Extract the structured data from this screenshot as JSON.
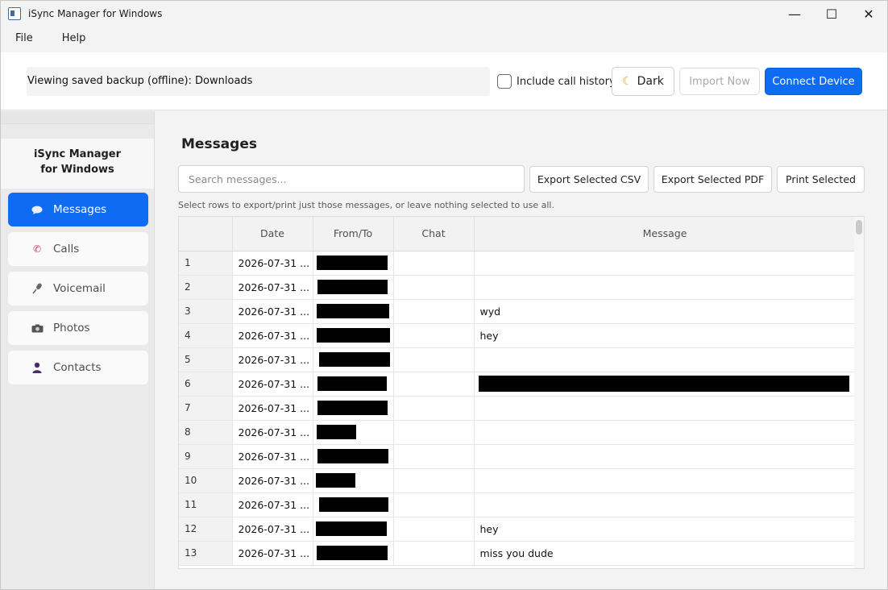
{
  "window": {
    "title": "iSync Manager for Windows",
    "controls": {
      "minimize": "—",
      "maximize": "☐",
      "close": "✕"
    }
  },
  "menu": {
    "items": [
      "File",
      "Help"
    ]
  },
  "toolbar": {
    "status": "Viewing saved backup (offline): Downloads",
    "include_call_history_label": "Include call history",
    "include_call_history_checked": false,
    "dark_label": "Dark",
    "import_label": "Import Now",
    "connect_label": "Connect Device"
  },
  "sidebar": {
    "header_line1": "iSync Manager",
    "header_line2": "for Windows",
    "items": [
      {
        "label": "Messages",
        "icon": "speech-bubble-icon",
        "glyph": "💬",
        "active": true
      },
      {
        "label": "Calls",
        "icon": "phone-icon",
        "glyph": "📞",
        "active": false
      },
      {
        "label": "Voicemail",
        "icon": "microphone-icon",
        "glyph": "🎤",
        "active": false
      },
      {
        "label": "Photos",
        "icon": "camera-icon",
        "glyph": "📷",
        "active": false
      },
      {
        "label": "Contacts",
        "icon": "person-icon",
        "glyph": "👤",
        "active": false
      }
    ]
  },
  "main": {
    "title": "Messages",
    "search_placeholder": "Search messages...",
    "export_csv_label": "Export Selected CSV",
    "export_pdf_label": "Export Selected PDF",
    "print_label": "Print Selected",
    "hint": "Select rows to export/print just those messages, or leave nothing selected to use all.",
    "table": {
      "columns": [
        "",
        "Date",
        "From/To",
        "Chat",
        "Message"
      ],
      "rows": [
        {
          "n": "1",
          "date": "2026-07-31 ...",
          "chat": "",
          "message": ""
        },
        {
          "n": "2",
          "date": "2026-07-31 ...",
          "chat": "",
          "message": ""
        },
        {
          "n": "3",
          "date": "2026-07-31 ...",
          "chat": "",
          "message": "wyd"
        },
        {
          "n": "4",
          "date": "2026-07-31 ...",
          "chat": "",
          "message": "hey"
        },
        {
          "n": "5",
          "date": "2026-07-31 ...",
          "chat": "",
          "message": ""
        },
        {
          "n": "6",
          "date": "2026-07-31 ...",
          "chat": "",
          "message": ""
        },
        {
          "n": "7",
          "date": "2026-07-31 ...",
          "chat": "",
          "message": ""
        },
        {
          "n": "8",
          "date": "2026-07-31 ...",
          "chat": "",
          "message": ""
        },
        {
          "n": "9",
          "date": "2026-07-31 ...",
          "chat": "",
          "message": ""
        },
        {
          "n": "10",
          "date": "2026-07-31 ...",
          "chat": "",
          "message": ""
        },
        {
          "n": "11",
          "date": "2026-07-31 ...",
          "chat": "",
          "message": ""
        },
        {
          "n": "12",
          "date": "2026-07-31 ...",
          "chat": "",
          "message": "hey"
        },
        {
          "n": "13",
          "date": "2026-07-31 ...",
          "chat": "",
          "message": "miss you dude"
        }
      ]
    }
  }
}
